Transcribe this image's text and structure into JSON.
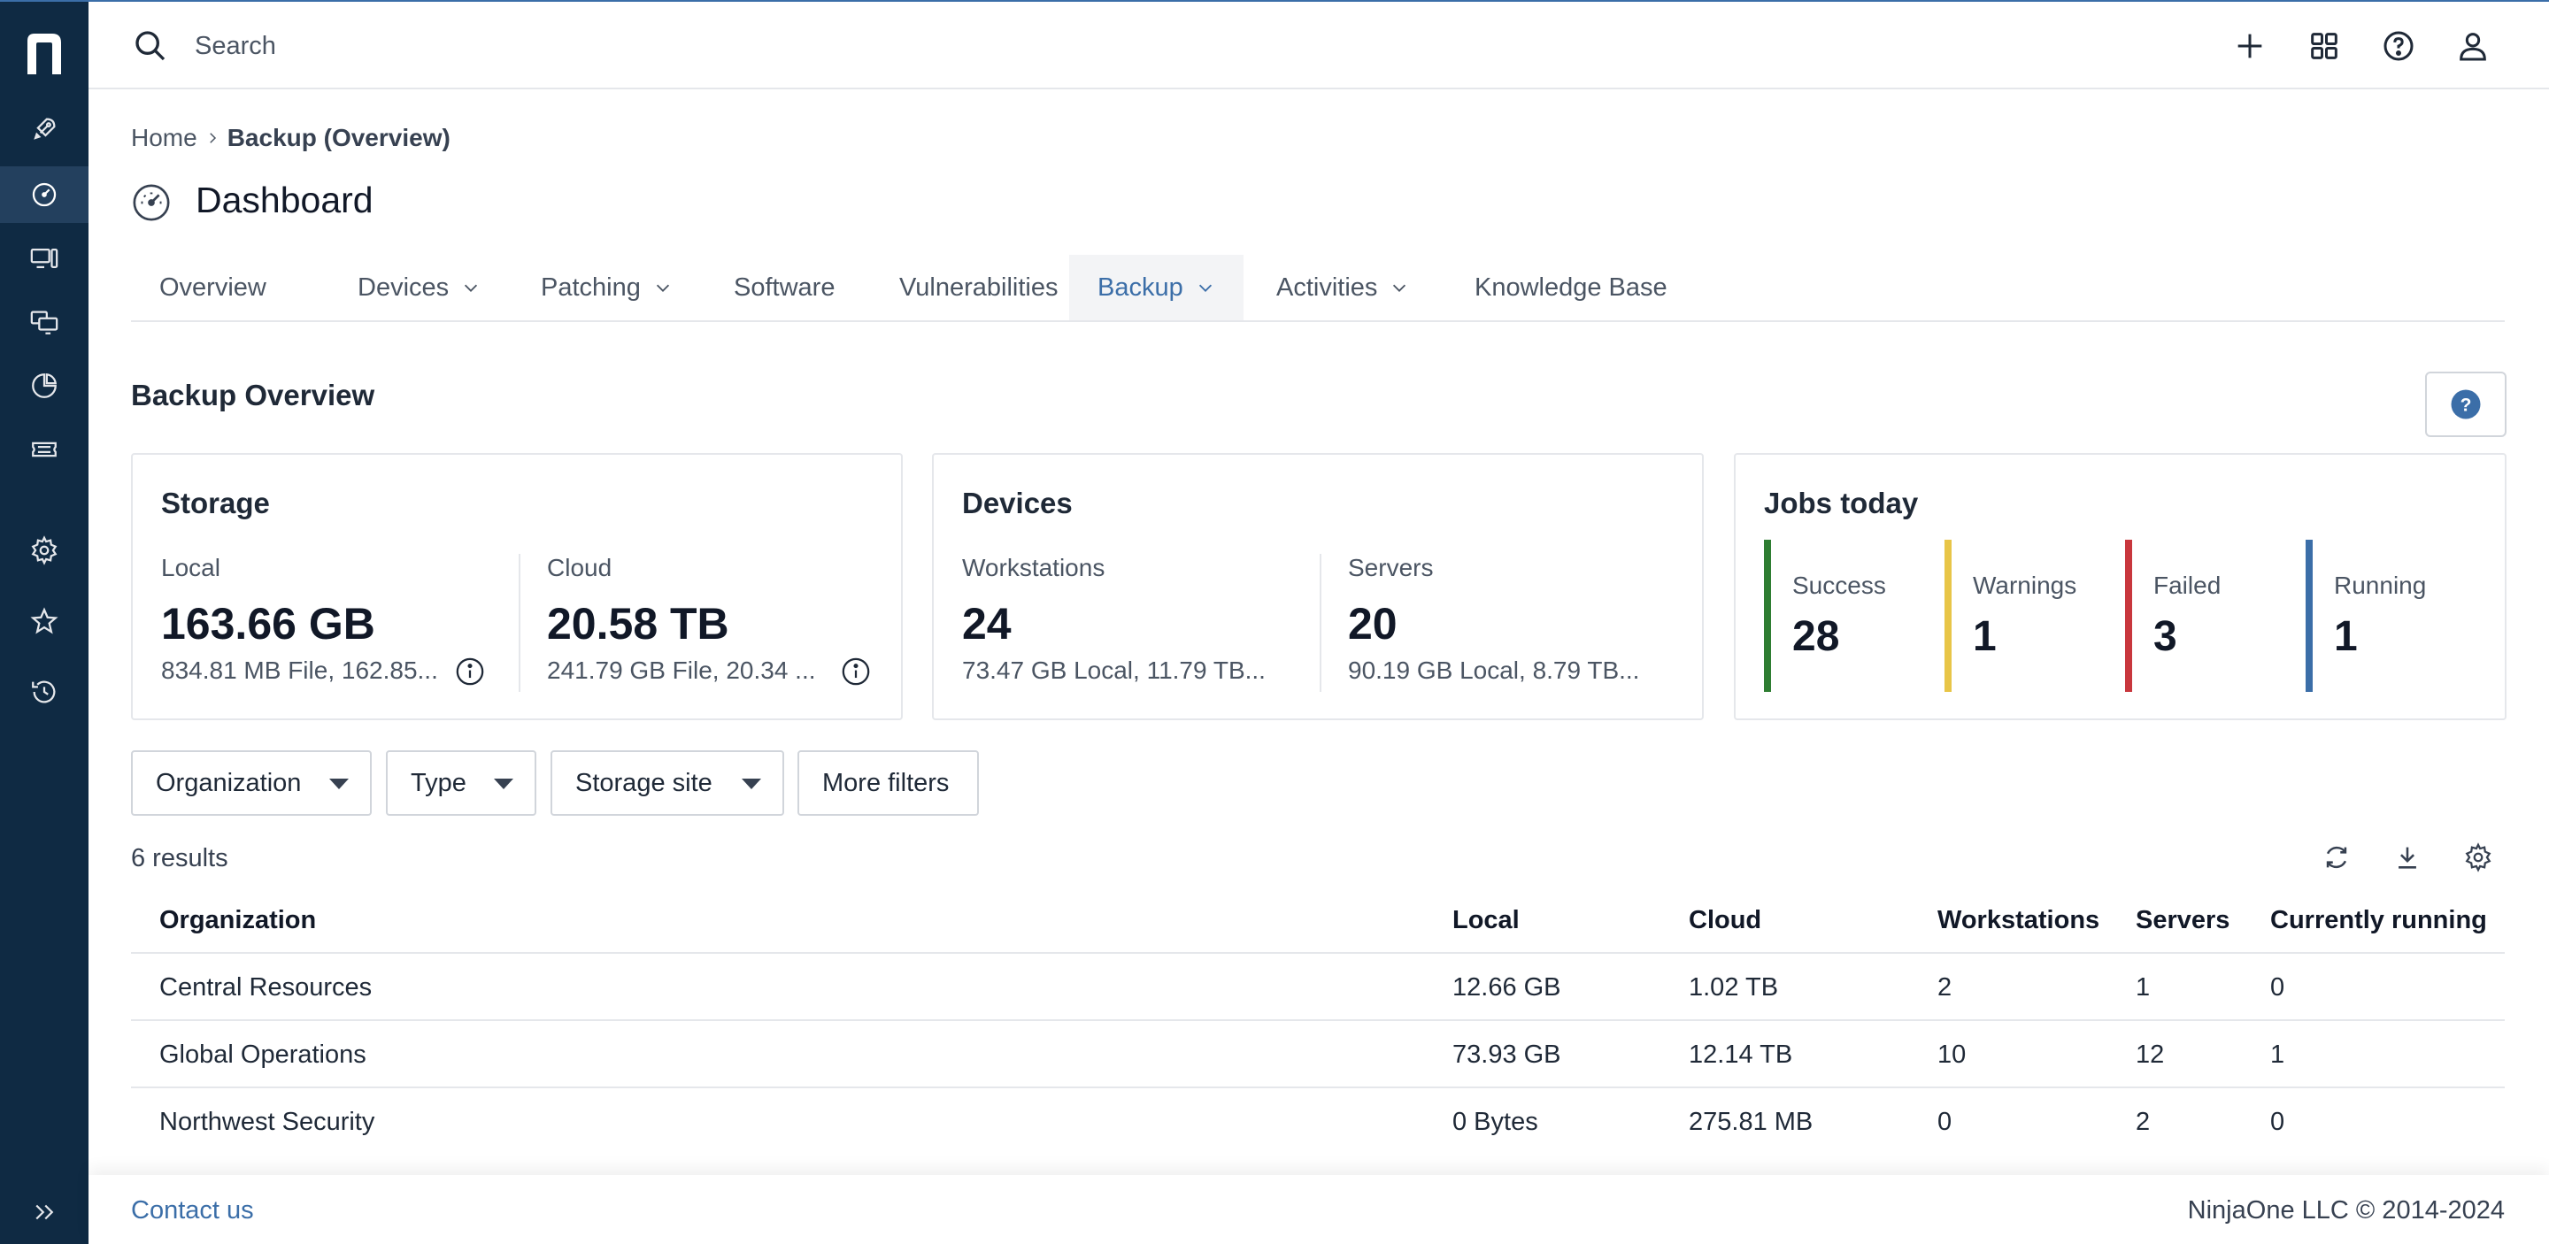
{
  "search": {
    "placeholder": "Search"
  },
  "breadcrumb": {
    "home": "Home",
    "current": "Backup (Overview)"
  },
  "page": {
    "title": "Dashboard"
  },
  "tabs": [
    {
      "label": "Overview"
    },
    {
      "label": "Devices"
    },
    {
      "label": "Patching"
    },
    {
      "label": "Software"
    },
    {
      "label": "Vulnerabilities"
    },
    {
      "label": "Backup"
    },
    {
      "label": "Activities"
    },
    {
      "label": "Knowledge Base"
    }
  ],
  "section": {
    "title": "Backup Overview",
    "help": "?"
  },
  "storage": {
    "title": "Storage",
    "local": {
      "label": "Local",
      "value": "163.66 GB",
      "sub": "834.81 MB File, 162.85..."
    },
    "cloud": {
      "label": "Cloud",
      "value": "20.58 TB",
      "sub": "241.79 GB File, 20.34 ..."
    }
  },
  "devices": {
    "title": "Devices",
    "workstations": {
      "label": "Workstations",
      "value": "24",
      "sub": "73.47 GB Local, 11.79 TB..."
    },
    "servers": {
      "label": "Servers",
      "value": "20",
      "sub": "90.19 GB Local, 8.79 TB..."
    }
  },
  "jobs": {
    "title": "Jobs today",
    "success": {
      "label": "Success",
      "value": "28",
      "color": "#2e7d32"
    },
    "warnings": {
      "label": "Warnings",
      "value": "1",
      "color": "#e8c547"
    },
    "failed": {
      "label": "Failed",
      "value": "3",
      "color": "#c8373d"
    },
    "running": {
      "label": "Running",
      "value": "1",
      "color": "#3b6ea8"
    }
  },
  "filters": {
    "organization": "Organization",
    "type": "Type",
    "storage_site": "Storage site",
    "more": "More filters"
  },
  "results": {
    "count": "6 results"
  },
  "table": {
    "headers": {
      "organization": "Organization",
      "local": "Local",
      "cloud": "Cloud",
      "workstations": "Workstations",
      "servers": "Servers",
      "running": "Currently running"
    },
    "rows": [
      {
        "organization": "Central Resources",
        "local": "12.66 GB",
        "cloud": "1.02 TB",
        "workstations": "2",
        "servers": "1",
        "running": "0"
      },
      {
        "organization": "Global Operations",
        "local": "73.93 GB",
        "cloud": "12.14 TB",
        "workstations": "10",
        "servers": "12",
        "running": "1"
      },
      {
        "organization": "Northwest Security",
        "local": "0 Bytes",
        "cloud": "275.81 MB",
        "workstations": "0",
        "servers": "2",
        "running": "0"
      }
    ]
  },
  "footer": {
    "contact": "Contact us",
    "copyright": "NinjaOne LLC © 2014-2024"
  },
  "colors": {
    "sidebar": "#0f2a43",
    "accent": "#3b6ea8"
  }
}
